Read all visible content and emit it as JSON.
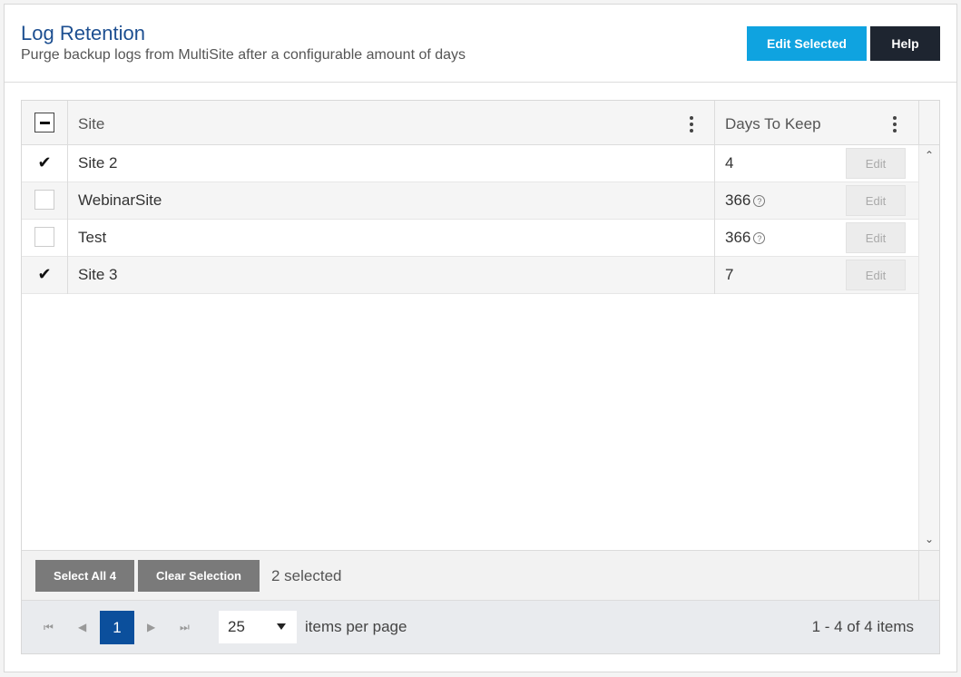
{
  "header": {
    "title": "Log Retention",
    "subtitle": "Purge backup logs from MultiSite after a configurable amount of days",
    "edit_selected_label": "Edit Selected",
    "help_label": "Help"
  },
  "grid": {
    "columns": [
      {
        "label": "Site"
      },
      {
        "label": "Days To Keep"
      }
    ],
    "rows": [
      {
        "site": "Site 2",
        "days": "4",
        "checked": true,
        "default_value": false,
        "edit_label": "Edit"
      },
      {
        "site": "WebinarSite",
        "days": "366",
        "checked": false,
        "default_value": true,
        "edit_label": "Edit"
      },
      {
        "site": "Test",
        "days": "366",
        "checked": false,
        "default_value": true,
        "edit_label": "Edit"
      },
      {
        "site": "Site 3",
        "days": "7",
        "checked": true,
        "default_value": false,
        "edit_label": "Edit"
      }
    ]
  },
  "selection": {
    "select_all_label": "Select All 4",
    "clear_label": "Clear Selection",
    "count_text": "2 selected"
  },
  "pager": {
    "current_page": "1",
    "page_size": "25",
    "items_per_page_label": "items per page",
    "info": "1 - 4 of 4 items"
  }
}
